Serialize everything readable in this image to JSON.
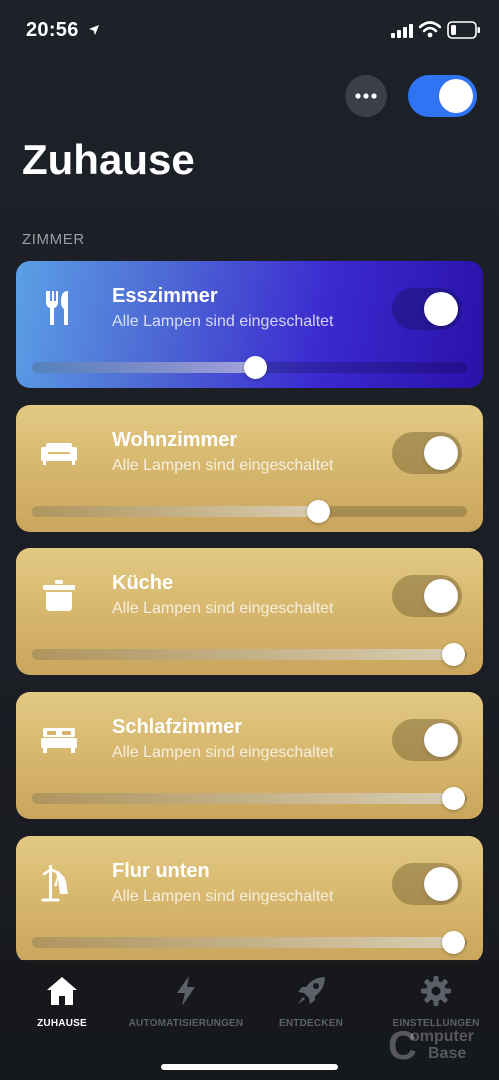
{
  "status": {
    "time": "20:56"
  },
  "header": {
    "title": "Zuhause",
    "more_icon": "ellipsis-icon",
    "master_toggle_on": true
  },
  "section": {
    "label": "ZIMMER"
  },
  "rooms": [
    {
      "name": "Esszimmer",
      "status": "Alle Lampen sind eingeschaltet",
      "icon": "fork-knife-icon",
      "on": true,
      "brightness": 0.53,
      "color": "#3b2ad0"
    },
    {
      "name": "Wohnzimmer",
      "status": "Alle Lampen sind eingeschaltet",
      "icon": "sofa-icon",
      "on": true,
      "brightness": 0.68,
      "color": "#d5b56b"
    },
    {
      "name": "Küche",
      "status": "Alle Lampen sind eingeschaltet",
      "icon": "cooking-pot-icon",
      "on": true,
      "brightness": 1.0,
      "color": "#d5b56b"
    },
    {
      "name": "Schlafzimmer",
      "status": "Alle Lampen sind eingeschaltet",
      "icon": "bed-icon",
      "on": true,
      "brightness": 1.0,
      "color": "#d5b56b"
    },
    {
      "name": "Flur unten",
      "status": "Alle Lampen sind eingeschaltet",
      "icon": "coat-rack-icon",
      "on": true,
      "brightness": 1.0,
      "color": "#d5b56b"
    }
  ],
  "tabs": [
    {
      "label": "ZUHAUSE",
      "icon": "home-icon",
      "active": true
    },
    {
      "label": "AUTOMATISIERUNGEN",
      "icon": "lightning-icon",
      "active": false
    },
    {
      "label": "ENTDECKEN",
      "icon": "rocket-icon",
      "active": false
    },
    {
      "label": "EINSTELLUNGEN",
      "icon": "gear-icon",
      "active": false
    }
  ],
  "watermark": {
    "line1": "omputer",
    "line2": "Base",
    "letter": "C"
  },
  "colors": {
    "accent": "#2f74f3",
    "background": "#1b1e24",
    "tab_inactive": "#5d6068"
  }
}
